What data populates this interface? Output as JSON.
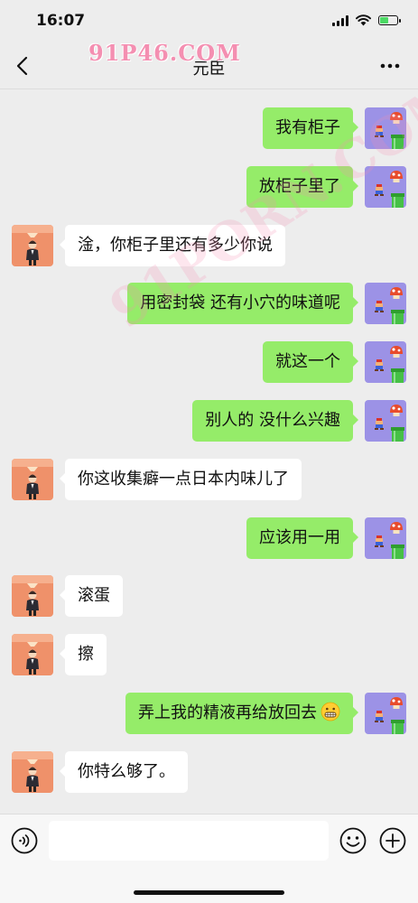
{
  "status_bar": {
    "time": "16:07",
    "battery_level": 0.55
  },
  "nav": {
    "title": "元臣",
    "back_icon": "chevron-left-icon",
    "more_icon": "more-dots-icon"
  },
  "watermarks": {
    "top": "91P46.COM",
    "diagonal": "91PORN.COM"
  },
  "messages": [
    {
      "from": "me",
      "text": "我有柜子"
    },
    {
      "from": "me",
      "text": "放柜子里了"
    },
    {
      "from": "contact",
      "text": "淦，你柜子里还有多少你说"
    },
    {
      "from": "me",
      "text": "用密封袋 还有小穴的味道呢"
    },
    {
      "from": "me",
      "text": "就这一个"
    },
    {
      "from": "me",
      "text": "别人的 没什么兴趣"
    },
    {
      "from": "contact",
      "text": "你这收集癖一点日本内味儿了"
    },
    {
      "from": "me",
      "text": "应该用一用"
    },
    {
      "from": "contact",
      "text": "滚蛋"
    },
    {
      "from": "contact",
      "text": "擦"
    },
    {
      "from": "me",
      "text": "弄上我的精液再给放回去",
      "emoji": "grimacing-face-icon"
    },
    {
      "from": "contact",
      "text": "你特么够了。"
    }
  ],
  "input_bar": {
    "value": "",
    "voice_icon": "voice-icon",
    "emoji_icon": "smiley-icon",
    "plus_icon": "plus-circle-icon"
  },
  "colors": {
    "background": "#ededed",
    "my_bubble": "#95ec69",
    "contact_bubble": "#ffffff",
    "watermark": "#f48fb1"
  }
}
